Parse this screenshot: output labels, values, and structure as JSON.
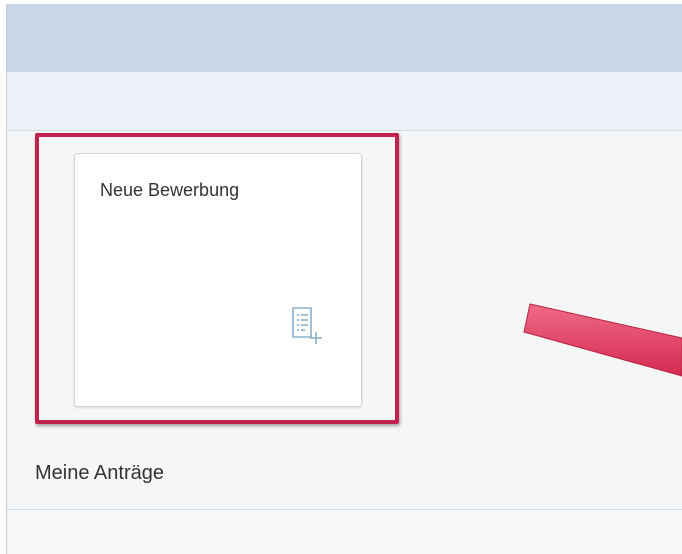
{
  "tile": {
    "title": "Neue Bewerbung",
    "icon": "document-add-icon"
  },
  "section": {
    "title": "Meine Anträge"
  },
  "annotation": {
    "highlight_color": "#c1214c",
    "arrow_color": "#e03a5d"
  },
  "colors": {
    "header_bar": "#c9d8e6",
    "subheader_bar": "#edf2f8",
    "content_bg": "#f5f6f8",
    "icon_color": "#8db0cc"
  }
}
